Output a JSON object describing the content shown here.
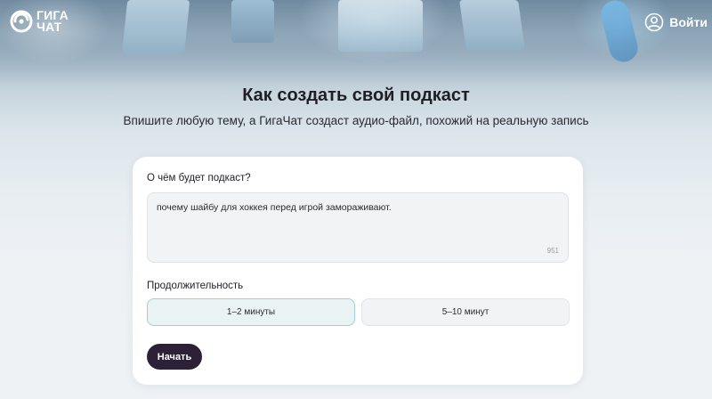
{
  "header": {
    "logo": {
      "line1": "ГИГА",
      "line2": "ЧАТ"
    },
    "login_label": "Войти"
  },
  "hero": {
    "title": "Как создать свой подкаст",
    "subtitle": "Впишите любую тему, а ГигаЧат создаст аудио-файл, похожий на реальную запись"
  },
  "form": {
    "topic_label": "О чём будет подкаст?",
    "topic_value": "почему шайбу для хоккея перед игрой замораживают.",
    "char_counter": "951",
    "duration_label": "Продолжительность",
    "duration_options": [
      {
        "label": "1–2 минуты",
        "selected": true
      },
      {
        "label": "5–10 минут",
        "selected": false
      }
    ],
    "start_label": "Начать"
  },
  "colors": {
    "accent_dark": "#2d2137",
    "selected_border": "#9ed1cf",
    "selected_fill": "#eaf3f3",
    "card_bg": "#ffffff"
  },
  "icons": {
    "logo": "gigachat-logo-icon",
    "login": "user-circle-icon"
  }
}
